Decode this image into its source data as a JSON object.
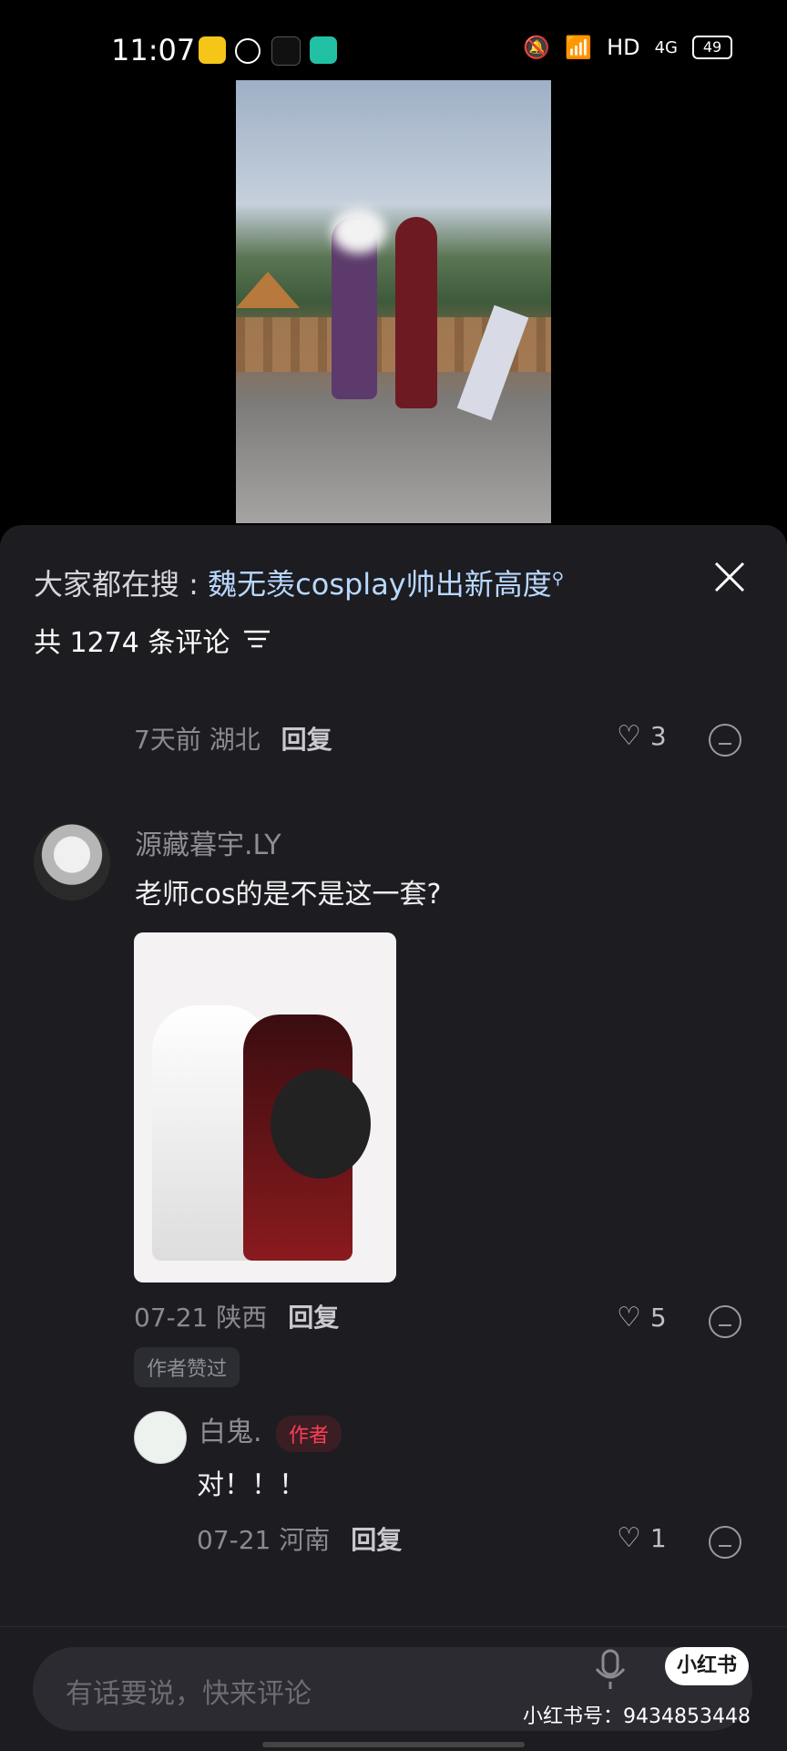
{
  "status_bar": {
    "time": "11:07",
    "network": "HD",
    "signal": "4G",
    "battery": "49"
  },
  "sheet": {
    "search_prefix": "大家都在搜 : ",
    "search_keyword": "魏无羡cosplay帅出新高度",
    "comment_count": "共 1274 条评论"
  },
  "comments": [
    {
      "time": "7天前",
      "location": "湖北",
      "reply": "回复",
      "likes": "3"
    },
    {
      "username": "源藏暮宇.LY",
      "text": "老师cos的是不是这一套?",
      "time": "07-21",
      "location": "陕西",
      "reply": "回复",
      "likes": "5",
      "badge": "作者赞过"
    },
    {
      "username": "白鬼.",
      "author_tag": "作者",
      "text": "对！！！",
      "time": "07-21",
      "location": "河南",
      "reply": "回复",
      "likes": "1"
    }
  ],
  "bottom_bar": {
    "placeholder": "有话要说，快来评论",
    "logo": "小红书",
    "watermark": "小红书号：9434853448"
  },
  "colors": {
    "sheet_bg": "#1c1c21",
    "accent_keyword": "#b9d8ff",
    "author_tag": "#ff3d55"
  }
}
